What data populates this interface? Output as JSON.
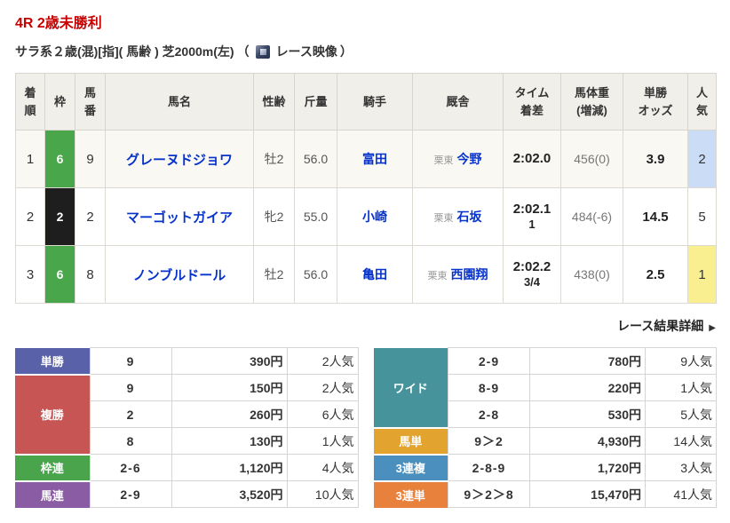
{
  "page": {
    "title": "4R 2歳未勝利",
    "race_conditions": "サラ系２歳(混)[指]( 馬齢 ) 芝2000m(左)",
    "paren_open": "（",
    "paren_close": "）",
    "video_link_label": "レース映像",
    "detail_link_label": "レース結果詳細",
    "detail_arrow": "▶"
  },
  "colors": {
    "title_red": "#c80000",
    "link_blue": "#0733cc",
    "header_bg": "#f1efe9",
    "frame_green": "#4aa64a",
    "frame_black": "#1e1e1e",
    "popularity_blue": "#cbdcf6",
    "popularity_yellow": "#f9ee90",
    "tansho": "#5961a8",
    "fukusho": "#c65553",
    "wakuren": "#4aa44c",
    "umaren": "#8a5ca4",
    "wide": "#46939c",
    "umatan": "#e3a42f",
    "sanrenpuku": "#4a8fbd",
    "sanrentan": "#e8813c"
  },
  "results": {
    "headers": [
      "着\n順",
      "枠",
      "馬\n番",
      "馬名",
      "性齢",
      "斤量",
      "騎手",
      "厩舎",
      "タイム\n着差",
      "馬体重\n(増減)",
      "単勝\nオッズ",
      "人\n気"
    ],
    "rows": [
      {
        "finish": "1",
        "frame": "6",
        "frame_color": "#4aa64a",
        "number": "9",
        "name": "グレーヌドジョワ",
        "sex_age": "牡2",
        "weight": "56.0",
        "jockey": "富田",
        "stable_area": "栗東",
        "stable": "今野",
        "time": "2:02.0",
        "margin": "",
        "horse_weight": "456(0)",
        "odds": "3.9",
        "popularity": "2",
        "popularity_bg": "#cbdcf6"
      },
      {
        "finish": "2",
        "frame": "2",
        "frame_color": "#1e1e1e",
        "number": "2",
        "name": "マーゴットガイア",
        "sex_age": "牝2",
        "weight": "55.0",
        "jockey": "小崎",
        "stable_area": "栗東",
        "stable": "石坂",
        "time": "2:02.1",
        "margin": "1",
        "horse_weight": "484(-6)",
        "odds": "14.5",
        "popularity": "5",
        "popularity_bg": ""
      },
      {
        "finish": "3",
        "frame": "6",
        "frame_color": "#4aa64a",
        "number": "8",
        "name": "ノンブルドール",
        "sex_age": "牡2",
        "weight": "56.0",
        "jockey": "亀田",
        "stable_area": "栗東",
        "stable": "西園翔",
        "time": "2:02.2",
        "margin": "3/4",
        "horse_weight": "438(0)",
        "odds": "2.5",
        "popularity": "1",
        "popularity_bg": "#f9ee90"
      }
    ]
  },
  "payouts_left": {
    "groups": [
      {
        "label": "単勝",
        "color": "#5961a8",
        "rows": [
          {
            "combo": "9",
            "amount": "390円",
            "popularity": "2人気"
          }
        ]
      },
      {
        "label": "複勝",
        "color": "#c65553",
        "rows": [
          {
            "combo": "9",
            "amount": "150円",
            "popularity": "2人気"
          },
          {
            "combo": "2",
            "amount": "260円",
            "popularity": "6人気"
          },
          {
            "combo": "8",
            "amount": "130円",
            "popularity": "1人気"
          }
        ]
      },
      {
        "label": "枠連",
        "color": "#4aa44c",
        "rows": [
          {
            "combo": "2-6",
            "amount": "1,120円",
            "popularity": "4人気"
          }
        ]
      },
      {
        "label": "馬連",
        "color": "#8a5ca4",
        "rows": [
          {
            "combo": "2-9",
            "amount": "3,520円",
            "popularity": "10人気"
          }
        ]
      }
    ]
  },
  "payouts_right": {
    "groups": [
      {
        "label": "ワイド",
        "color": "#46939c",
        "rows": [
          {
            "combo": "2-9",
            "amount": "780円",
            "popularity": "9人気"
          },
          {
            "combo": "8-9",
            "amount": "220円",
            "popularity": "1人気"
          },
          {
            "combo": "2-8",
            "amount": "530円",
            "popularity": "5人気"
          }
        ]
      },
      {
        "label": "馬単",
        "color": "#e3a42f",
        "rows": [
          {
            "combo": "9＞2",
            "amount": "4,930円",
            "popularity": "14人気"
          }
        ]
      },
      {
        "label": "3連複",
        "color": "#4a8fbd",
        "rows": [
          {
            "combo": "2-8-9",
            "amount": "1,720円",
            "popularity": "3人気"
          }
        ]
      },
      {
        "label": "3連単",
        "color": "#e8813c",
        "rows": [
          {
            "combo": "9＞2＞8",
            "amount": "15,470円",
            "popularity": "41人気"
          }
        ]
      }
    ]
  }
}
